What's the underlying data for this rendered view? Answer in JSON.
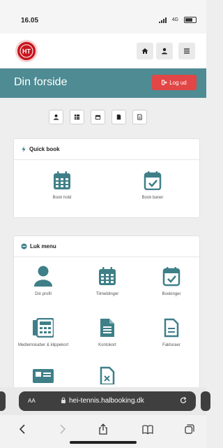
{
  "status_bar": {
    "time": "16.05",
    "network": "4G"
  },
  "header": {
    "logo_text": "HT",
    "icons": [
      "home-icon",
      "user-icon",
      "menu-icon"
    ]
  },
  "title_bar": {
    "title": "Din forside",
    "logout_label": "Log ud"
  },
  "toolbar_icons": [
    "user-icon",
    "table-icon",
    "calendar-icon",
    "document-icon",
    "invoice-icon"
  ],
  "quick_book": {
    "title": "Quick book",
    "items": [
      {
        "label": "Book hold",
        "icon": "calendar-grid-icon"
      },
      {
        "label": "Book baner",
        "icon": "calendar-check-icon"
      }
    ]
  },
  "menu": {
    "title": "Luk menu",
    "items": [
      {
        "label": "Din profil",
        "icon": "user-icon"
      },
      {
        "label": "Tilmeldinger",
        "icon": "calendar-grid-icon"
      },
      {
        "label": "Bookinger",
        "icon": "calendar-check-icon"
      },
      {
        "label": "Medlemskaber & klippekort",
        "icon": "membership-card-icon"
      },
      {
        "label": "Kontokort",
        "icon": "document-icon"
      },
      {
        "label": "Fakturaer",
        "icon": "invoice-icon"
      }
    ]
  },
  "browser": {
    "aa_label": "AA",
    "url": "hei-tennis.halbooking.dk"
  },
  "colors": {
    "teal": "#4e8b93",
    "red": "#e24646",
    "brand": "#c8161d"
  }
}
